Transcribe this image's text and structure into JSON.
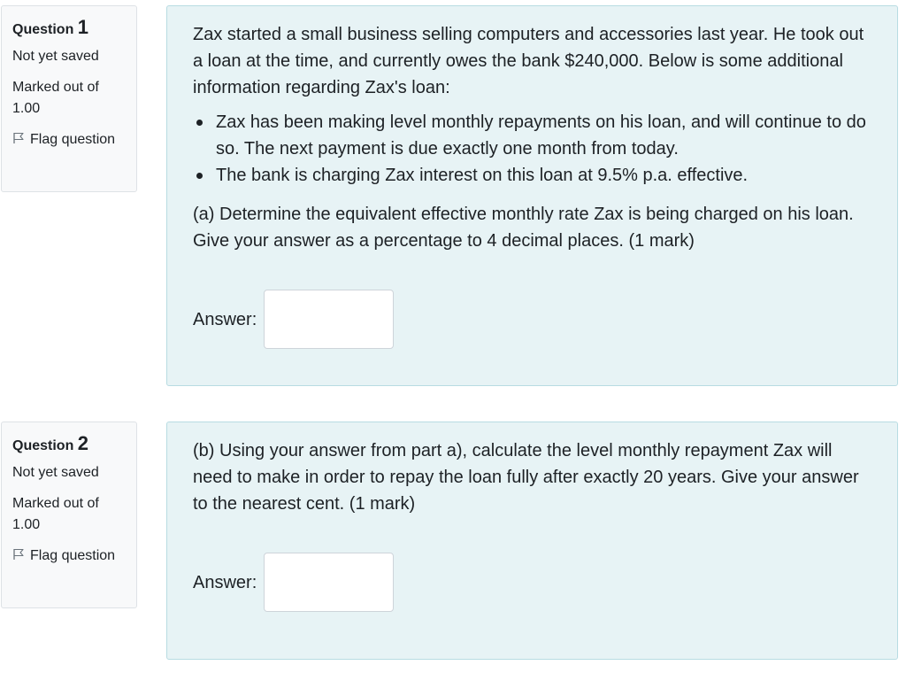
{
  "questions": [
    {
      "label": "Question",
      "number": "1",
      "state": "Not yet saved",
      "grade": "Marked out of 1.00",
      "flag": "Flag question",
      "intro": "Zax started a small business selling computers and accessories last year. He took out a loan at the time, and currently owes the bank $240,000. Below is some additional information regarding Zax's loan:",
      "bullets": [
        "Zax has been making level monthly repayments on his loan, and will continue to do so. The next payment is due exactly one month from today.",
        "The bank is charging Zax interest on this loan at 9.5% p.a. effective."
      ],
      "prompt": "(a) Determine the equivalent effective monthly rate Zax is being charged on his loan. Give your answer as a percentage to 4 decimal places. (1 mark)",
      "answer_label": "Answer:",
      "answer_value": ""
    },
    {
      "label": "Question",
      "number": "2",
      "state": "Not yet saved",
      "grade": "Marked out of 1.00",
      "flag": "Flag question",
      "prompt": "(b) Using your answer from part a), calculate the level monthly repayment Zax will need to make in order to repay the loan fully after exactly 20 years. Give your answer to the nearest cent. (1 mark)",
      "answer_label": "Answer:",
      "answer_value": ""
    }
  ],
  "colors": {
    "content_bg": "#e7f3f5",
    "content_border": "#b8dce2",
    "info_bg": "#f8f9fa",
    "text": "#1d2125"
  }
}
